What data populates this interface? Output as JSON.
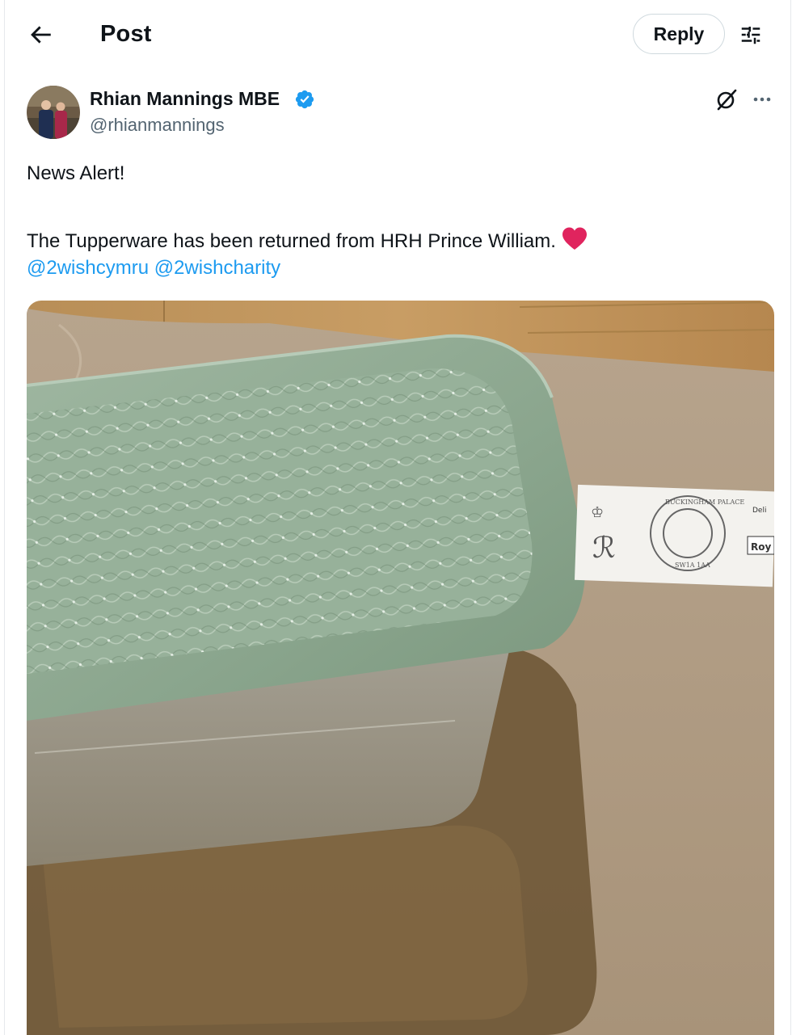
{
  "header": {
    "title": "Post",
    "reply_label": "Reply"
  },
  "author": {
    "name": "Rhian Mannings MBE",
    "handle": "@rhianmannings",
    "verified": true
  },
  "post": {
    "line1": "News Alert!",
    "line2": "The Tupperware has been returned from HRH Prince William.",
    "mentions": [
      "@2wishcymru",
      "@2wishcharity"
    ]
  },
  "media": {
    "label_stamp_top": "BUCKINGHAM PALACE",
    "label_stamp_bottom": "SW1A 1AA",
    "label_right_top": "Deli",
    "label_right_bottom": "Roy"
  },
  "icons": {
    "back": "arrow-left-icon",
    "tune": "sliders-icon",
    "verified": "verified-badge-icon",
    "grok": "grok-icon",
    "more": "more-dots-icon",
    "heart": "heart-emoji-icon"
  },
  "colors": {
    "accent": "#1d9bf0",
    "text": "#0f1419",
    "muted": "#536471",
    "heart": "#e0245e"
  }
}
